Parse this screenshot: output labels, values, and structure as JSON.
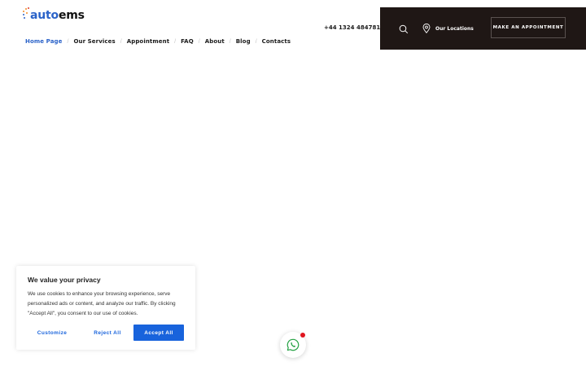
{
  "brand": {
    "logo_part1": "auto",
    "logo_part2": "ems"
  },
  "nav": {
    "items": [
      {
        "label": "Home Page",
        "active": true
      },
      {
        "label": "Our Services"
      },
      {
        "label": "Appointment"
      },
      {
        "label": "FAQ"
      },
      {
        "label": "About"
      },
      {
        "label": "Blog"
      },
      {
        "label": "Contacts"
      }
    ],
    "separator": "/"
  },
  "header": {
    "phone": "+44 1324 484781",
    "locations_label": "Our Locations",
    "appointment_button": "MAKE AN APPOINTMENT",
    "search_icon": "search-icon",
    "location_icon": "map-pin-icon"
  },
  "cookie_banner": {
    "title": "We value your privacy",
    "text": "We use cookies to enhance your browsing experience, serve personalized ads or content, and analyze our traffic. By clicking \"Accept All\", you consent to our use of cookies.",
    "customize_label": "Customize",
    "reject_label": "Reject All",
    "accept_label": "Accept All"
  },
  "whatsapp": {
    "icon": "whatsapp-icon",
    "notification": true
  },
  "colors": {
    "accent": "#2b63c9",
    "header_dark": "#1f1715",
    "cookie_button": "#1863dc",
    "notification_dot": "#e0141e"
  }
}
